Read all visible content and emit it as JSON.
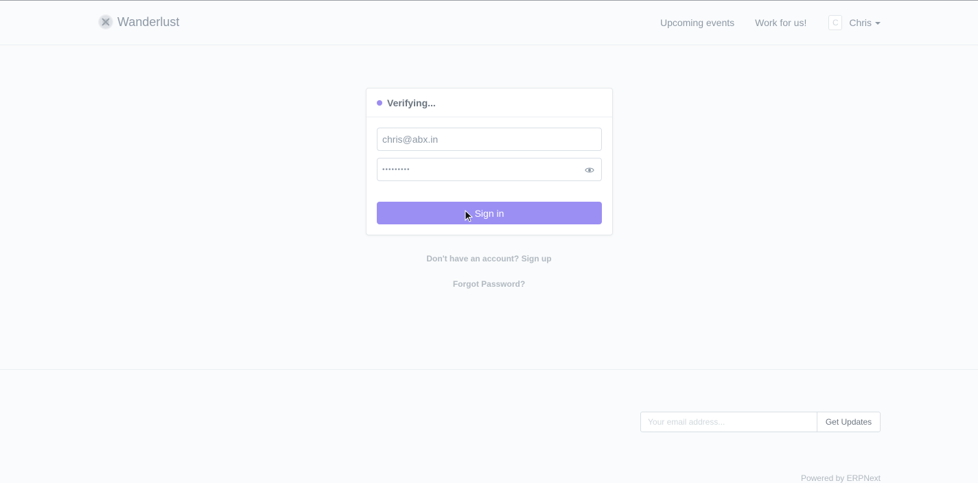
{
  "navbar": {
    "brand": "Wanderlust",
    "links": [
      "Upcoming events",
      "Work for us!"
    ],
    "user": {
      "initial": "C",
      "name": "Chris"
    }
  },
  "login": {
    "status": "Verifying...",
    "email_value": "chris@abx.in",
    "password_mask": "•••••••••",
    "sign_in_label": "Sign in",
    "signup_text": "Don't have an account? Sign up",
    "forgot_text": "Forgot Password?"
  },
  "footer": {
    "subscribe_placeholder": "Your email address...",
    "get_updates_label": "Get Updates",
    "powered_by": "Powered by ERPNext"
  },
  "colors": {
    "accent": "#9b8ff3",
    "status_dot": "#9d8cf0",
    "text_muted": "#8d99a6"
  }
}
